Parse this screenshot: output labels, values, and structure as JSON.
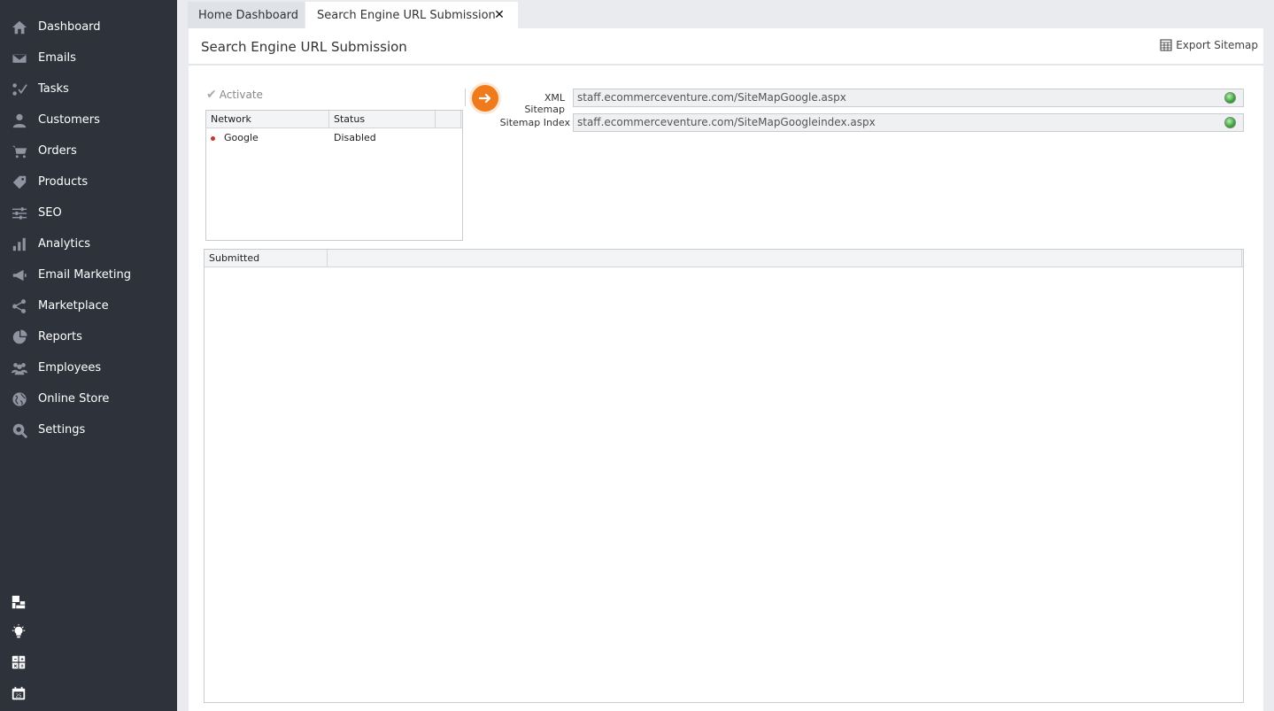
{
  "sidebar": {
    "items": [
      {
        "label": "Dashboard",
        "icon": "home-icon"
      },
      {
        "label": "Emails",
        "icon": "envelope-icon"
      },
      {
        "label": "Tasks",
        "icon": "tasks-icon"
      },
      {
        "label": "Customers",
        "icon": "user-icon"
      },
      {
        "label": "Orders",
        "icon": "cart-icon"
      },
      {
        "label": "Products",
        "icon": "tag-icon"
      },
      {
        "label": "SEO",
        "icon": "sliders-icon"
      },
      {
        "label": "Analytics",
        "icon": "bar-chart-icon"
      },
      {
        "label": "Email Marketing",
        "icon": "megaphone-icon"
      },
      {
        "label": "Marketplace",
        "icon": "share-icon"
      },
      {
        "label": "Reports",
        "icon": "pie-chart-icon"
      },
      {
        "label": "Employees",
        "icon": "users-icon"
      },
      {
        "label": "Online Store",
        "icon": "globe-icon"
      },
      {
        "label": "Settings",
        "icon": "gear-icon"
      }
    ],
    "bottom_icons": [
      "windows-icon",
      "lightbulb-icon",
      "calculator-icon",
      "calendar-icon"
    ]
  },
  "tabs": {
    "home": "Home Dashboard",
    "active": "Search Engine URL Submission",
    "close": "✕"
  },
  "header": {
    "title": "Search Engine URL Submission",
    "export_label": "Export Sitemap"
  },
  "network_panel": {
    "activate_label": "Activate",
    "columns": [
      "Network",
      "Status"
    ],
    "rows": [
      {
        "network": "Google",
        "status": "Disabled",
        "status_color": "#c0392b"
      }
    ]
  },
  "sitemap": {
    "xml_label": "XML Sitemap",
    "xml_value": "staff.ecommerceventure.com/SiteMapGoogle.aspx",
    "index_label": "Sitemap Index",
    "index_value": "staff.ecommerceventure.com/SiteMapGoogleindex.aspx"
  },
  "submitted_grid": {
    "columns": [
      "Submitted"
    ]
  },
  "colors": {
    "sidebar_bg": "#2d323b",
    "accent": "#f07b1c"
  }
}
